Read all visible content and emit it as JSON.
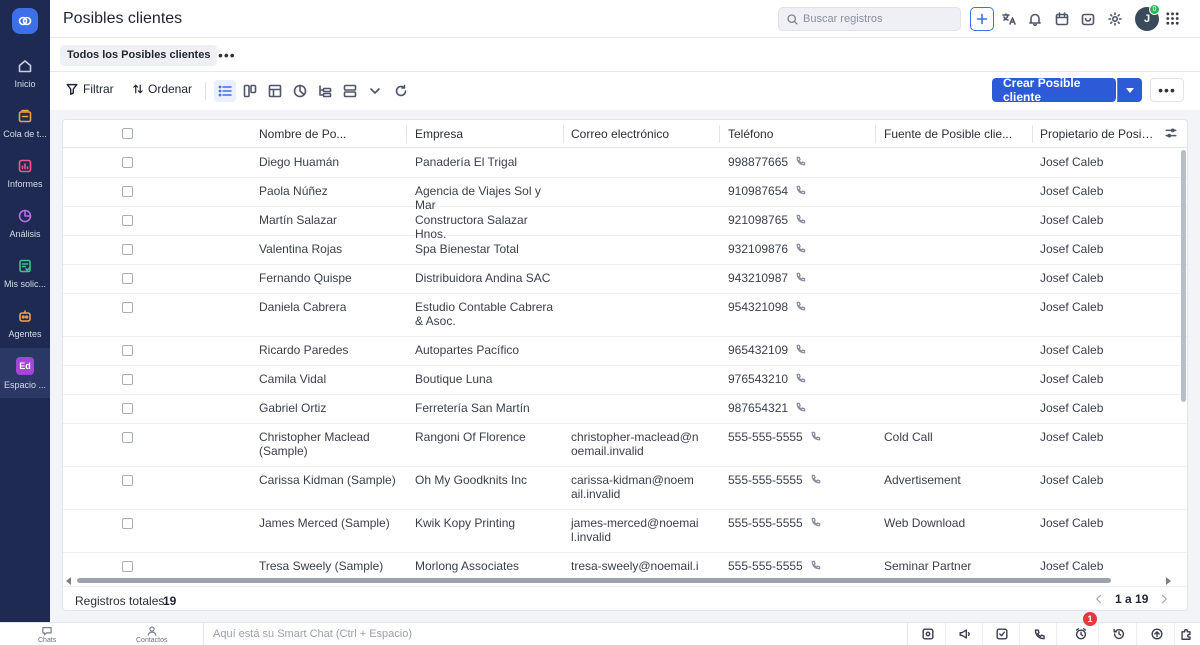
{
  "sidebar": {
    "logo_icon": "crm-logo-icon",
    "items": [
      {
        "label": "Inicio",
        "icon": "home-icon"
      },
      {
        "label": "Cola de t...",
        "icon": "queue-icon"
      },
      {
        "label": "Informes",
        "icon": "reports-icon"
      },
      {
        "label": "Análisis",
        "icon": "analytics-icon"
      },
      {
        "label": "Mis solic...",
        "icon": "requests-icon"
      },
      {
        "label": "Agentes",
        "icon": "agents-icon"
      },
      {
        "label": "Espacio ...",
        "icon": "workspace-badge",
        "badge": "Ed"
      }
    ]
  },
  "header": {
    "title": "Posibles clientes",
    "search_placeholder": "Buscar registros",
    "avatar_initial": "J",
    "avatar_badge": "0"
  },
  "views": {
    "current": "Todos los Posibles clientes",
    "more": "•••"
  },
  "toolbar": {
    "filter_label": "Filtrar",
    "sort_label": "Ordenar",
    "create_label": "Crear Posible cliente",
    "more": "•••"
  },
  "table": {
    "columns": [
      "Nombre de Po...",
      "Empresa",
      "Correo electrónico",
      "Teléfono",
      "Fuente de Posible clie...",
      "Propietario de Posible..."
    ],
    "rows": [
      {
        "name": "Diego Huamán",
        "company": "Panadería El Trigal",
        "email": "",
        "phone": "998877665",
        "source": "",
        "owner": "Josef Caleb"
      },
      {
        "name": "Paola Núñez",
        "company": "Agencia de Viajes Sol y Mar",
        "email": "",
        "phone": "910987654",
        "source": "",
        "owner": "Josef Caleb"
      },
      {
        "name": "Martín Salazar",
        "company": "Constructora Salazar Hnos.",
        "email": "",
        "phone": "921098765",
        "source": "",
        "owner": "Josef Caleb"
      },
      {
        "name": "Valentina Rojas",
        "company": "Spa Bienestar Total",
        "email": "",
        "phone": "932109876",
        "source": "",
        "owner": "Josef Caleb"
      },
      {
        "name": "Fernando Quispe",
        "company": "Distribuidora Andina SAC",
        "email": "",
        "phone": "943210987",
        "source": "",
        "owner": "Josef Caleb"
      },
      {
        "name": "Daniela Cabrera",
        "company": "Estudio Contable Cabrera & Asoc.",
        "email": "",
        "phone": "954321098",
        "source": "",
        "owner": "Josef Caleb"
      },
      {
        "name": "Ricardo Paredes",
        "company": "Autopartes Pacífico",
        "email": "",
        "phone": "965432109",
        "source": "",
        "owner": "Josef Caleb"
      },
      {
        "name": "Camila Vidal",
        "company": "Boutique Luna",
        "email": "",
        "phone": "976543210",
        "source": "",
        "owner": "Josef Caleb"
      },
      {
        "name": "Gabriel Ortiz",
        "company": "Ferretería San Martín",
        "email": "",
        "phone": "987654321",
        "source": "",
        "owner": "Josef Caleb"
      },
      {
        "name": "Christopher Maclead (Sample)",
        "company": "Rangoni Of Florence",
        "email": "christopher-maclead@noemail.invalid",
        "phone": "555-555-5555",
        "source": "Cold Call",
        "owner": "Josef Caleb"
      },
      {
        "name": "Carissa Kidman (Sample)",
        "company": "Oh My Goodknits Inc",
        "email": "carissa-kidman@noemail.invalid",
        "phone": "555-555-5555",
        "source": "Advertisement",
        "owner": "Josef Caleb"
      },
      {
        "name": "James Merced (Sample)",
        "company": "Kwik Kopy Printing",
        "email": "james-merced@noemail.invalid",
        "phone": "555-555-5555",
        "source": "Web Download",
        "owner": "Josef Caleb"
      },
      {
        "name": "Tresa Sweely (Sample)",
        "company": "Morlong Associates",
        "email": "tresa-sweely@noemail.invalid",
        "phone": "555-555-5555",
        "source": "Seminar Partner",
        "owner": "Josef Caleb"
      }
    ],
    "footer": {
      "total_label": "Registros totales",
      "total_value": "19",
      "page_range": "1 a 19"
    }
  },
  "bottombar": {
    "chats_label": "Chats",
    "contacts_label": "Contactos",
    "smartchat_placeholder": "Aquí está su Smart Chat (Ctrl + Espacio)",
    "notification_count": "1"
  },
  "colors": {
    "sidebar_bg": "#1f2a52",
    "accent": "#2d5bd7",
    "notification": "#e5393c"
  }
}
